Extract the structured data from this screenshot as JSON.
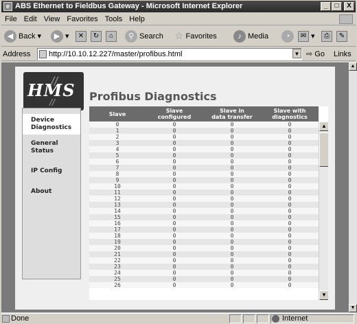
{
  "window": {
    "title": "ABS Ethernet to Fieldbus Gateway - Microsoft Internet Explorer",
    "minimize": "_",
    "maximize": "□",
    "close": "X"
  },
  "menu": [
    "File",
    "Edit",
    "View",
    "Favorites",
    "Tools",
    "Help"
  ],
  "toolbar": {
    "back_label": "Back",
    "search_label": "Search",
    "favorites_label": "Favorites",
    "media_label": "Media"
  },
  "address": {
    "label": "Address",
    "url": "http://10.10.12.227/master/profibus.html",
    "go_label": "Go",
    "links_label": "Links"
  },
  "page": {
    "logo_text": "HMS",
    "title": "Profibus Diagnostics",
    "nav": [
      {
        "line1": "Device",
        "line2": "Diagnostics"
      },
      {
        "line1": "General",
        "line2": "Status"
      },
      {
        "line1": "IP Config",
        "line2": ""
      },
      {
        "line1": "About",
        "line2": ""
      }
    ]
  },
  "table": {
    "headers": [
      {
        "l1": "Slave",
        "l2": ""
      },
      {
        "l1": "Slave",
        "l2": "configured"
      },
      {
        "l1": "Slave in",
        "l2": "data transfer"
      },
      {
        "l1": "Slave with",
        "l2": "diagnostics"
      }
    ],
    "rows": [
      [
        "0",
        "0",
        "0",
        "0"
      ],
      [
        "1",
        "0",
        "0",
        "0"
      ],
      [
        "2",
        "0",
        "0",
        "0"
      ],
      [
        "3",
        "0",
        "0",
        "0"
      ],
      [
        "4",
        "0",
        "0",
        "0"
      ],
      [
        "5",
        "0",
        "0",
        "0"
      ],
      [
        "6",
        "0",
        "0",
        "0"
      ],
      [
        "7",
        "0",
        "0",
        "0"
      ],
      [
        "8",
        "0",
        "0",
        "0"
      ],
      [
        "9",
        "0",
        "0",
        "0"
      ],
      [
        "10",
        "0",
        "0",
        "0"
      ],
      [
        "11",
        "0",
        "0",
        "0"
      ],
      [
        "12",
        "0",
        "0",
        "0"
      ],
      [
        "13",
        "0",
        "0",
        "0"
      ],
      [
        "14",
        "0",
        "0",
        "0"
      ],
      [
        "15",
        "0",
        "0",
        "0"
      ],
      [
        "16",
        "0",
        "0",
        "0"
      ],
      [
        "17",
        "0",
        "0",
        "0"
      ],
      [
        "18",
        "0",
        "0",
        "0"
      ],
      [
        "19",
        "0",
        "0",
        "0"
      ],
      [
        "20",
        "0",
        "0",
        "0"
      ],
      [
        "21",
        "0",
        "0",
        "0"
      ],
      [
        "22",
        "0",
        "0",
        "0"
      ],
      [
        "23",
        "0",
        "0",
        "0"
      ],
      [
        "24",
        "0",
        "0",
        "0"
      ],
      [
        "25",
        "0",
        "0",
        "0"
      ],
      [
        "26",
        "0",
        "0",
        "0"
      ]
    ]
  },
  "status": {
    "text": "Done",
    "zone": "Internet"
  }
}
